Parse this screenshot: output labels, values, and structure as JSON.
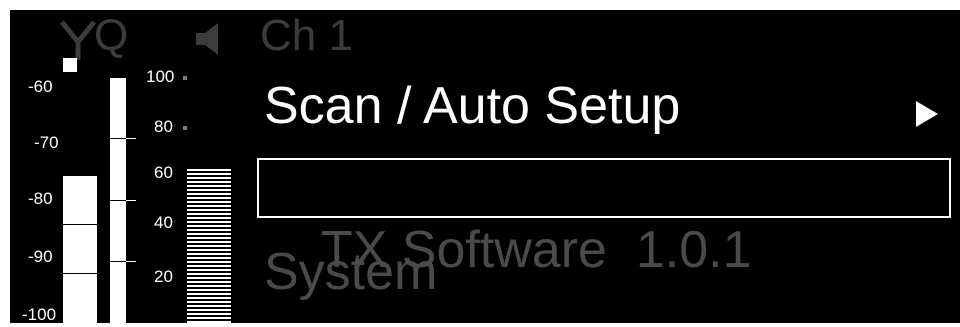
{
  "status_bar": {
    "antenna_icon": "antenna-icon",
    "diversity_label": "Q",
    "speaker_icon": "speaker-icon",
    "channel": "Ch 1"
  },
  "rf_meter": {
    "scale_labels": [
      "-60",
      "-70",
      "-80",
      "-90",
      "-100"
    ],
    "level_fraction": 0.62,
    "squelch_marker": "white-square"
  },
  "af_meter": {
    "scale_labels": [
      "100",
      "80",
      "60",
      "40",
      "20"
    ],
    "level_fraction": 0.68
  },
  "menu": {
    "items": [
      {
        "label": "Scan / Auto Setup",
        "state": "active",
        "has_submenu": true
      },
      {
        "label": "TX Software  1.0.1",
        "state": "selected-dim"
      },
      {
        "label": "System",
        "state": "dim"
      }
    ]
  },
  "colors": {
    "background": "#000000",
    "foreground": "#ffffff",
    "dim_text": "#4a4a4a",
    "status_dim": "#3c3c3c"
  }
}
